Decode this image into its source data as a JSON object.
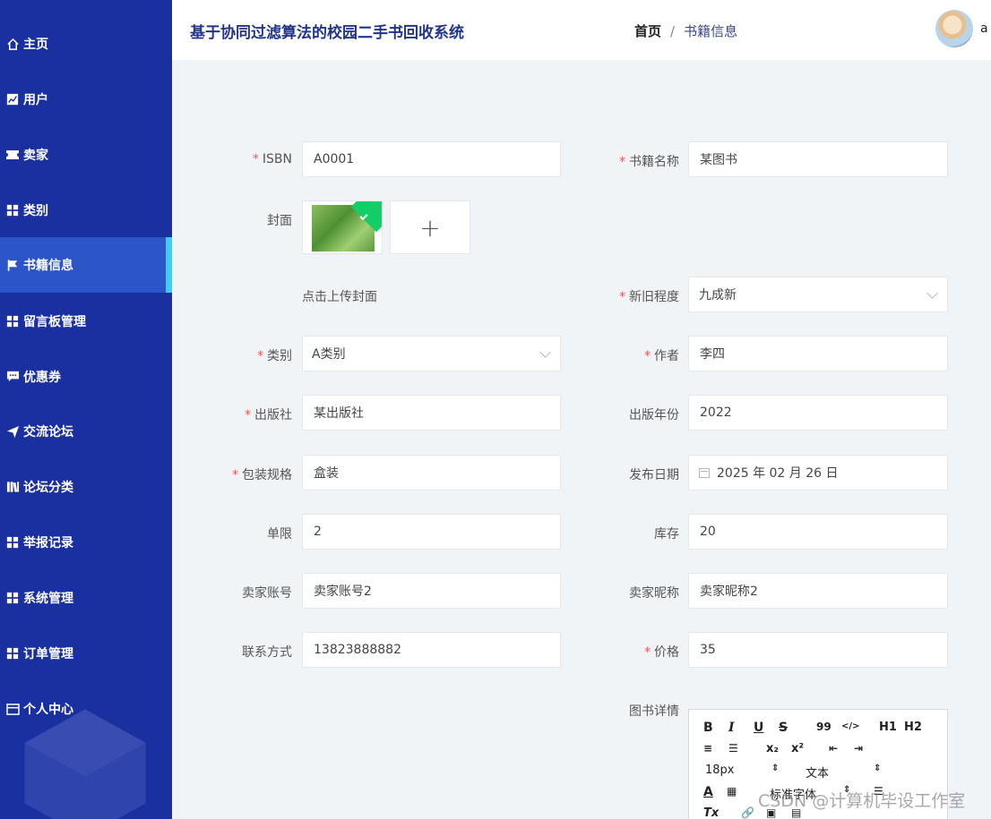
{
  "app": {
    "title": "基于协同过滤算法的校园二手书回收系统"
  },
  "breadcrumb": {
    "home": "首页",
    "sep": "/",
    "current": "书籍信息"
  },
  "user": {
    "name": "a"
  },
  "sidebar": {
    "items": [
      {
        "label": "主页",
        "icon": "home-icon"
      },
      {
        "label": "用户",
        "icon": "chart-icon"
      },
      {
        "label": "卖家",
        "icon": "ticket-icon"
      },
      {
        "label": "类别",
        "icon": "grid-icon"
      },
      {
        "label": "书籍信息",
        "icon": "flag-icon"
      },
      {
        "label": "留言板管理",
        "icon": "grid-icon"
      },
      {
        "label": "优惠券",
        "icon": "message-icon"
      },
      {
        "label": "交流论坛",
        "icon": "send-icon"
      },
      {
        "label": "论坛分类",
        "icon": "book-icon"
      },
      {
        "label": "举报记录",
        "icon": "grid-icon"
      },
      {
        "label": "系统管理",
        "icon": "grid-icon"
      },
      {
        "label": "订单管理",
        "icon": "grid-icon"
      },
      {
        "label": "个人中心",
        "icon": "card-icon"
      }
    ]
  },
  "form": {
    "isbn": {
      "label": "ISBN",
      "value": "A0001"
    },
    "name": {
      "label": "书籍名称",
      "value": "某图书"
    },
    "cover": {
      "label": "封面",
      "hint": "点击上传封面",
      "plus": "+"
    },
    "condition": {
      "label": "新旧程度",
      "value": "九成新"
    },
    "category": {
      "label": "类别",
      "value": "A类别"
    },
    "author": {
      "label": "作者",
      "value": "李四"
    },
    "publisher": {
      "label": "出版社",
      "value": "某出版社"
    },
    "pub_year": {
      "label": "出版年份",
      "value": "2022"
    },
    "packaging": {
      "label": "包装规格",
      "value": "盒装"
    },
    "release_date": {
      "label": "发布日期",
      "value": "2025 年 02 月 26 日"
    },
    "limit": {
      "label": "单限",
      "value": "2"
    },
    "stock": {
      "label": "库存",
      "value": "20"
    },
    "seller_account": {
      "label": "卖家账号",
      "value": "卖家账号2"
    },
    "seller_nick": {
      "label": "卖家昵称",
      "value": "卖家昵称2"
    },
    "contact": {
      "label": "联系方式",
      "value": "13823888882"
    },
    "price": {
      "label": "价格",
      "value": "35"
    },
    "detail": {
      "label": "图书详情"
    }
  },
  "editor": {
    "bold": "B",
    "italic": "I",
    "underline": "U",
    "strike": "S",
    "quote": "99",
    "code": "</>",
    "h1": "H1",
    "h2": "H2",
    "sub": "x₂",
    "sup": "x²",
    "size": "18px",
    "header": "文本",
    "font": "标准字体",
    "color": "A",
    "clear": "Tx"
  },
  "watermark": "CSDN @计算机毕设工作室"
}
